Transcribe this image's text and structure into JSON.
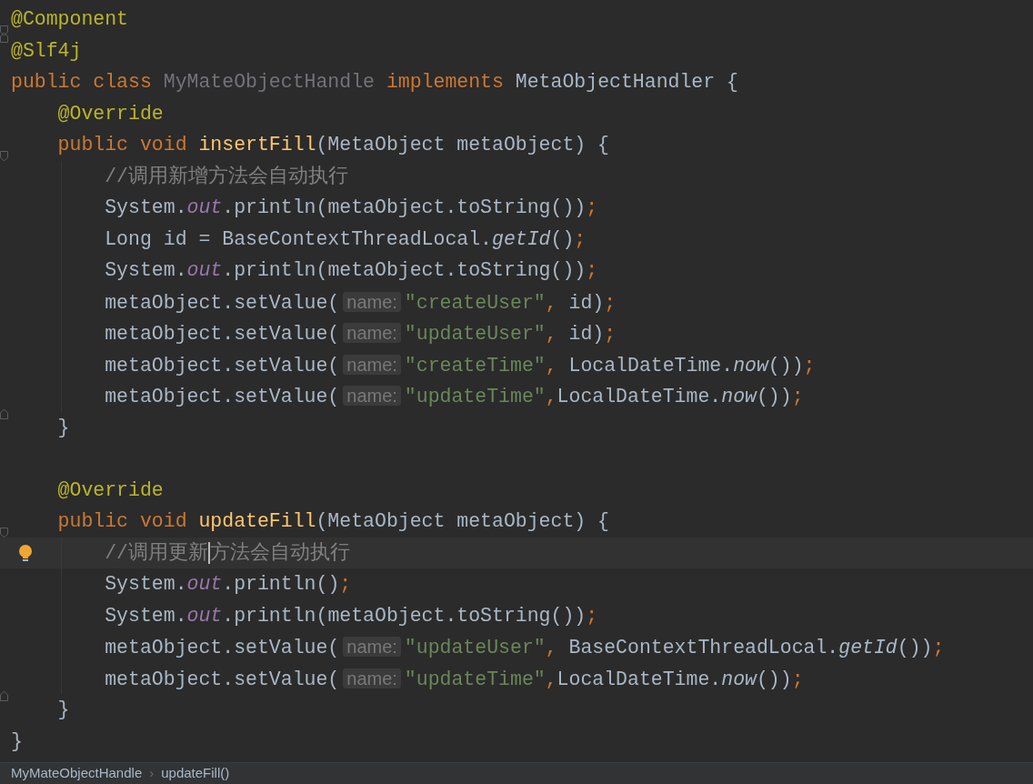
{
  "editor": {
    "lines": [
      {
        "kind": "fold-start",
        "tokens": [
          {
            "text": "@Component",
            "kind": "annotation"
          }
        ]
      },
      {
        "kind": "fold-end",
        "tokens": [
          {
            "text": "@Slf4j",
            "kind": "annotation"
          }
        ]
      },
      {
        "kind": "plain",
        "tokens": [
          {
            "text": "public class ",
            "kind": "keyword"
          },
          {
            "text": "MyMateObjectHandle",
            "kind": "unused"
          },
          {
            "text": " implements ",
            "kind": "keyword"
          },
          {
            "text": "MetaObjectHandler {",
            "kind": "plain"
          }
        ]
      },
      {
        "kind": "plain",
        "tokens": [
          {
            "text": "    @Override",
            "kind": "annotation"
          }
        ]
      },
      {
        "kind": "fold-start",
        "tokens": [
          {
            "text": "    public void ",
            "kind": "keyword"
          },
          {
            "text": "insertFill",
            "kind": "method"
          },
          {
            "text": "(MetaObject metaObject) {",
            "kind": "plain"
          }
        ]
      },
      {
        "kind": "plain",
        "tokens": [
          {
            "text": "        //调用新增方法会自动执行",
            "kind": "comment"
          }
        ]
      },
      {
        "kind": "plain",
        "tokens": [
          {
            "text": "        System.",
            "kind": "plain"
          },
          {
            "text": "out",
            "kind": "field"
          },
          {
            "text": ".println(metaObject.toString())",
            "kind": "plain"
          },
          {
            "text": ";",
            "kind": "punct"
          }
        ]
      },
      {
        "kind": "plain",
        "tokens": [
          {
            "text": "        Long id = BaseContextThreadLocal.",
            "kind": "plain"
          },
          {
            "text": "getId",
            "kind": "static"
          },
          {
            "text": "()",
            "kind": "plain"
          },
          {
            "text": ";",
            "kind": "punct"
          }
        ]
      },
      {
        "kind": "plain",
        "tokens": [
          {
            "text": "        System.",
            "kind": "plain"
          },
          {
            "text": "out",
            "kind": "field"
          },
          {
            "text": ".println(metaObject.toString())",
            "kind": "plain"
          },
          {
            "text": ";",
            "kind": "punct"
          }
        ]
      },
      {
        "kind": "plain",
        "tokens": [
          {
            "text": "        metaObject.setValue(",
            "kind": "plain"
          },
          {
            "text": "name:",
            "kind": "hint"
          },
          {
            "text": "\"createUser\"",
            "kind": "string"
          },
          {
            "text": ",",
            "kind": "punct"
          },
          {
            "text": " id)",
            "kind": "plain"
          },
          {
            "text": ";",
            "kind": "punct"
          }
        ]
      },
      {
        "kind": "plain",
        "tokens": [
          {
            "text": "        metaObject.setValue(",
            "kind": "plain"
          },
          {
            "text": "name:",
            "kind": "hint"
          },
          {
            "text": "\"updateUser\"",
            "kind": "string"
          },
          {
            "text": ",",
            "kind": "punct"
          },
          {
            "text": " id)",
            "kind": "plain"
          },
          {
            "text": ";",
            "kind": "punct"
          }
        ]
      },
      {
        "kind": "plain",
        "tokens": [
          {
            "text": "        metaObject.setValue(",
            "kind": "plain"
          },
          {
            "text": "name:",
            "kind": "hint"
          },
          {
            "text": "\"createTime\"",
            "kind": "string"
          },
          {
            "text": ",",
            "kind": "punct"
          },
          {
            "text": " LocalDateTime.",
            "kind": "plain"
          },
          {
            "text": "now",
            "kind": "static"
          },
          {
            "text": "())",
            "kind": "plain"
          },
          {
            "text": ";",
            "kind": "punct"
          }
        ]
      },
      {
        "kind": "plain",
        "tokens": [
          {
            "text": "        metaObject.setValue(",
            "kind": "plain"
          },
          {
            "text": "name:",
            "kind": "hint"
          },
          {
            "text": "\"updateTime\"",
            "kind": "string"
          },
          {
            "text": ",",
            "kind": "punct"
          },
          {
            "text": "LocalDateTime.",
            "kind": "plain"
          },
          {
            "text": "now",
            "kind": "static"
          },
          {
            "text": "())",
            "kind": "plain"
          },
          {
            "text": ";",
            "kind": "punct"
          }
        ]
      },
      {
        "kind": "fold-end",
        "tokens": [
          {
            "text": "    }",
            "kind": "plain"
          }
        ]
      },
      {
        "kind": "plain"
      },
      {
        "kind": "plain",
        "tokens": [
          {
            "text": "    @Override",
            "kind": "annotation"
          }
        ]
      },
      {
        "kind": "fold-start",
        "tokens": [
          {
            "text": "    public void ",
            "kind": "keyword"
          },
          {
            "text": "updateFill",
            "kind": "method"
          },
          {
            "text": "(MetaObject metaObject) {",
            "kind": "plain"
          }
        ]
      },
      {
        "kind": "bulb",
        "tokens": [
          {
            "text": "        //调用更新",
            "kind": "comment"
          },
          {
            "kind": "caret"
          },
          {
            "text": "方法会自动执行",
            "kind": "comment"
          }
        ]
      },
      {
        "kind": "plain",
        "tokens": [
          {
            "text": "        System.",
            "kind": "plain"
          },
          {
            "text": "out",
            "kind": "field"
          },
          {
            "text": ".println()",
            "kind": "plain"
          },
          {
            "text": ";",
            "kind": "punct"
          }
        ]
      },
      {
        "kind": "plain",
        "tokens": [
          {
            "text": "        System.",
            "kind": "plain"
          },
          {
            "text": "out",
            "kind": "field"
          },
          {
            "text": ".println(metaObject.toString())",
            "kind": "plain"
          },
          {
            "text": ";",
            "kind": "punct"
          }
        ]
      },
      {
        "kind": "plain",
        "tokens": [
          {
            "text": "        metaObject.setValue(",
            "kind": "plain"
          },
          {
            "text": "name:",
            "kind": "hint"
          },
          {
            "text": "\"updateUser\"",
            "kind": "string"
          },
          {
            "text": ",",
            "kind": "punct"
          },
          {
            "text": " BaseContextThreadLocal.",
            "kind": "plain"
          },
          {
            "text": "getId",
            "kind": "static"
          },
          {
            "text": "())",
            "kind": "plain"
          },
          {
            "text": ";",
            "kind": "punct"
          }
        ]
      },
      {
        "kind": "plain",
        "tokens": [
          {
            "text": "        metaObject.setValue(",
            "kind": "plain"
          },
          {
            "text": "name:",
            "kind": "hint"
          },
          {
            "text": "\"updateTime\"",
            "kind": "string"
          },
          {
            "text": ",",
            "kind": "punct"
          },
          {
            "text": "LocalDateTime.",
            "kind": "plain"
          },
          {
            "text": "now",
            "kind": "static"
          },
          {
            "text": "())",
            "kind": "plain"
          },
          {
            "text": ";",
            "kind": "punct"
          }
        ]
      },
      {
        "kind": "fold-end",
        "tokens": [
          {
            "text": "    }",
            "kind": "plain"
          }
        ]
      },
      {
        "kind": "plain",
        "tokens": [
          {
            "text": "}",
            "kind": "plain"
          }
        ]
      }
    ]
  },
  "breadcrumbs": {
    "separator": "›",
    "items": [
      "MyMateObjectHandle",
      "updateFill()"
    ]
  }
}
